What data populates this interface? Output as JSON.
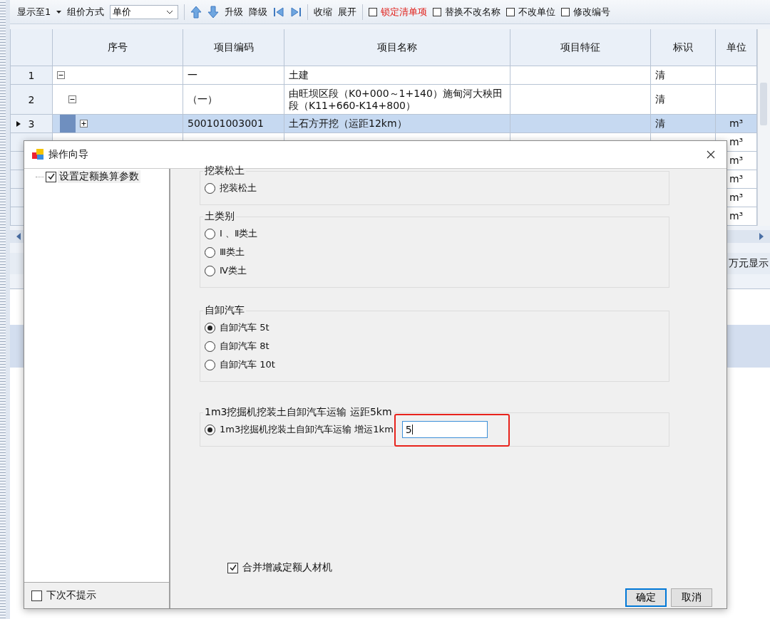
{
  "toolbar": {
    "level_label": "显示至1",
    "pricing_label": "组价方式",
    "pricing_value": "单价",
    "actions": [
      "升级",
      "降级"
    ],
    "fold_actions": [
      "收缩",
      "展开"
    ],
    "options": [
      {
        "label": "锁定清单项",
        "checked": false,
        "warning": true
      },
      {
        "label": "替换不改名称",
        "checked": false,
        "warning": false
      },
      {
        "label": "不改单位",
        "checked": false,
        "warning": false
      },
      {
        "label": "修改编号",
        "checked": false,
        "warning": false
      }
    ]
  },
  "table": {
    "columns": [
      "序号",
      "项目编码",
      "项目名称",
      "项目特征",
      "标识",
      "单位"
    ],
    "rows": [
      {
        "index": "1",
        "code": "一",
        "name": "土建",
        "flag": "清",
        "expanded": true,
        "selected": false,
        "children": [
          {
            "index": "2",
            "code": "（一）",
            "name": "由旺坝区段（K0+000～1+140）施甸河大秧田段（K11+660-K14+800）",
            "flag": "清",
            "expanded": true,
            "selected": false,
            "children": [
              {
                "index": "3",
                "code": "500101003001",
                "name": "土石方开挖（运距12km）",
                "flag": "清",
                "unit": "m³",
                "expanded": false,
                "selected": true
              },
              {
                "unit": "m³",
                "selected": false
              },
              {
                "unit": "m³",
                "selected": false
              },
              {
                "unit": "m³",
                "selected": false
              },
              {
                "unit": "m³",
                "selected": false
              },
              {
                "unit": "m³",
                "selected": false
              }
            ]
          }
        ]
      }
    ]
  },
  "status": {
    "unit_toggle": "万元显示"
  },
  "dialog": {
    "title": "操作向导",
    "tree": [
      {
        "label": "设置定额换算参数",
        "checked": true
      }
    ],
    "dont_show_again": {
      "label": "下次不提示",
      "checked": false
    },
    "groups": [
      {
        "title": "挖装松土",
        "options": [
          {
            "label": "挖装松土",
            "selected": false
          }
        ]
      },
      {
        "title": "土类别",
        "options": [
          {
            "label": "Ⅰ 、Ⅱ类土",
            "selected": false
          },
          {
            "label": "Ⅲ类土",
            "selected": false
          },
          {
            "label": "Ⅳ类土",
            "selected": false
          }
        ]
      },
      {
        "title": "自卸汽车",
        "options": [
          {
            "label": "自卸汽车 5t",
            "selected": true
          },
          {
            "label": "自卸汽车 8t",
            "selected": false
          },
          {
            "label": "自卸汽车 10t",
            "selected": false
          }
        ]
      },
      {
        "title": "1m3挖掘机挖装土自卸汽车运输 运距5km",
        "options": [
          {
            "label": "1m3挖掘机挖装土自卸汽车运输 增运1km",
            "selected": true,
            "value": "5",
            "highlighted": true
          }
        ]
      }
    ],
    "merge": {
      "label": "合并增减定额人材机",
      "checked": true
    },
    "buttons": [
      {
        "label": "确定",
        "default": true
      },
      {
        "label": "取消",
        "default": false
      }
    ]
  }
}
